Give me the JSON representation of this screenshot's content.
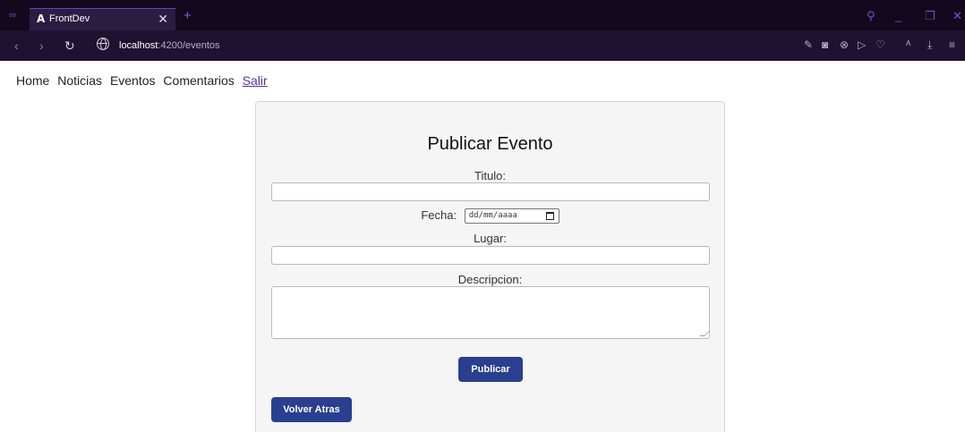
{
  "browser": {
    "tab_title": "FrontDev",
    "tab_logo": "A",
    "url_host": "localhost",
    "url_path": ":4200/eventos"
  },
  "nav": {
    "links": [
      "Home",
      "Noticias",
      "Eventos",
      "Comentarios"
    ],
    "logout": "Salir"
  },
  "form": {
    "title": "Publicar Evento",
    "titulo_label": "Titulo:",
    "titulo_value": "",
    "fecha_label": "Fecha:",
    "fecha_placeholder": "dd/mm/aaaa",
    "lugar_label": "Lugar:",
    "lugar_value": "",
    "descripcion_label": "Descripcion:",
    "descripcion_value": "",
    "publish_button": "Publicar",
    "back_button": "Volver Atras"
  },
  "colors": {
    "accent": "#2a3f8f",
    "browser_bg": "#12091f",
    "link": "#5a2ea6"
  }
}
